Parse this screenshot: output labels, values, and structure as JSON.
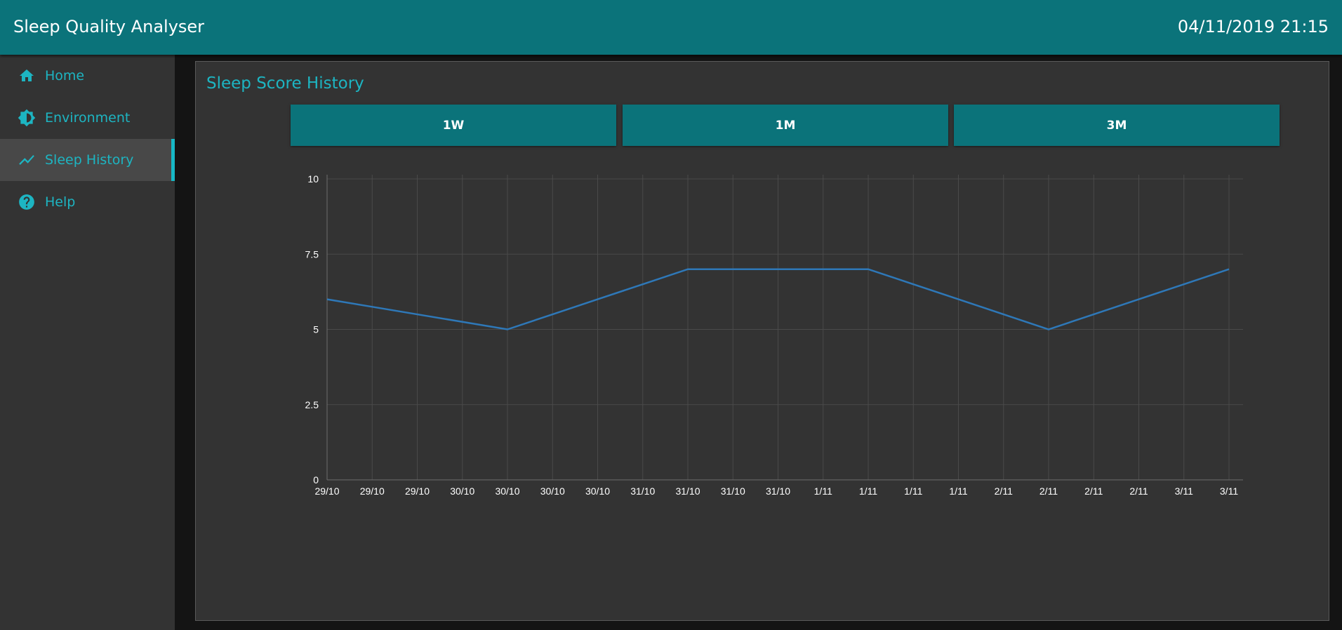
{
  "app": {
    "title": "Sleep Quality Analyser",
    "datetime": "04/11/2019 21:15"
  },
  "sidebar": {
    "items": [
      {
        "label": "Home",
        "icon": "home-icon",
        "active": false
      },
      {
        "label": "Environment",
        "icon": "brightness-icon",
        "active": false
      },
      {
        "label": "Sleep History",
        "icon": "trending-up-icon",
        "active": true
      },
      {
        "label": "Help",
        "icon": "help-circle-icon",
        "active": false
      }
    ]
  },
  "main": {
    "card_title": "Sleep Score History",
    "range_buttons": [
      "1W",
      "1M",
      "3M"
    ]
  },
  "colors": {
    "accent": "#0b737a",
    "accent_text": "#1db5c2",
    "line": "#2e78b8",
    "panel": "#333333"
  },
  "chart_data": {
    "type": "line",
    "x": [
      "29/10",
      "29/10",
      "29/10",
      "30/10",
      "30/10",
      "30/10",
      "30/10",
      "31/10",
      "31/10",
      "31/10",
      "31/10",
      "1/11",
      "1/11",
      "1/11",
      "1/11",
      "2/11",
      "2/11",
      "2/11",
      "2/11",
      "3/11",
      "3/11"
    ],
    "series": [
      {
        "values": [
          6,
          5.75,
          5.5,
          5.25,
          5,
          5.5,
          6,
          6.5,
          7,
          7,
          7,
          7,
          7,
          6.5,
          6,
          5.5,
          5,
          5.5,
          6,
          6.5,
          7
        ]
      }
    ],
    "ylim": [
      0,
      10
    ],
    "yticks": [
      "0",
      "2.5",
      "5",
      "7.5",
      "10"
    ],
    "grid": true
  }
}
